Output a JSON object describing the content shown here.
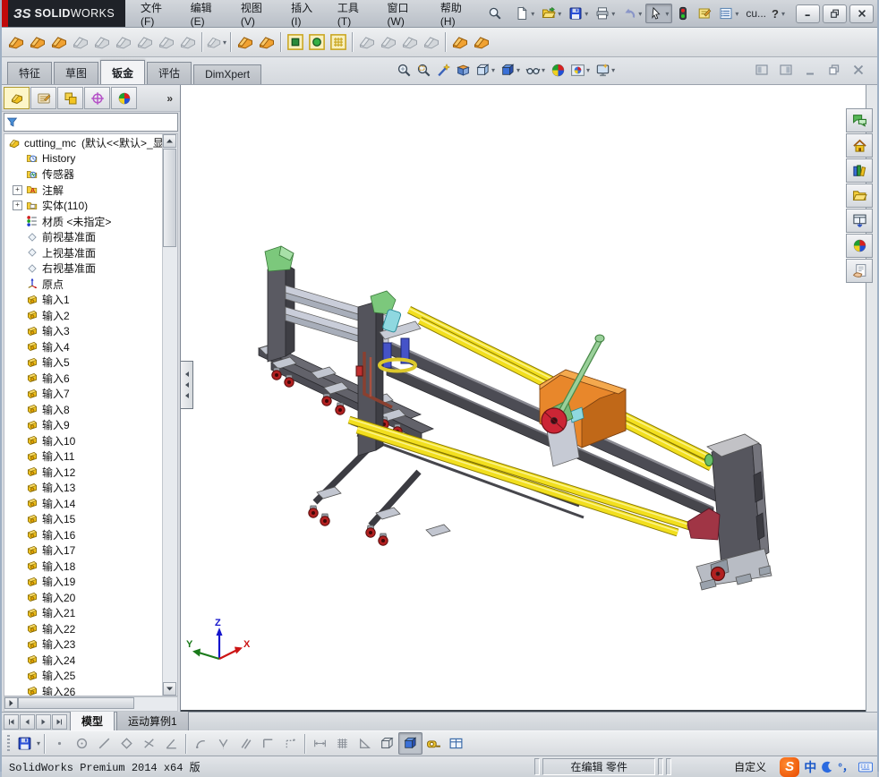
{
  "titlebar": {
    "logo_mark": "ЗS",
    "logo_bold": "SOLID",
    "logo_light": "WORKS",
    "menus": [
      "文件(F)",
      "编辑(E)",
      "视图(V)",
      "插入(I)",
      "工具(T)",
      "窗口(W)",
      "帮助(H)"
    ],
    "quickbar": [
      {
        "icon": "new-document",
        "dd": true
      },
      {
        "icon": "open-folder",
        "dd": true
      },
      {
        "icon": "save-floppy",
        "dd": true
      },
      {
        "icon": "print",
        "dd": true
      },
      {
        "icon": "undo-arrow",
        "dd": true
      },
      {
        "icon": "select-cursor",
        "dd": true,
        "pressed": true
      },
      {
        "icon": "rebuild-traffic-light"
      },
      {
        "icon": "edit-note"
      },
      {
        "icon": "options-list",
        "dd": true
      }
    ],
    "doc_overflow": "cu...",
    "help_mark": "?",
    "window_buttons": [
      "minimize",
      "restore",
      "close"
    ]
  },
  "sheetmetal_toolbar": [
    {
      "name": "base-flange",
      "style": "colored"
    },
    {
      "name": "convert-to-sheetmetal",
      "style": "colored"
    },
    {
      "name": "lofted-bend",
      "style": "colored"
    },
    {
      "name": "edge-flange",
      "style": "gray"
    },
    {
      "name": "miter-flange",
      "style": "gray"
    },
    {
      "name": "hem",
      "style": "gray"
    },
    {
      "name": "jog",
      "style": "gray"
    },
    {
      "name": "sketched-bend",
      "style": "gray"
    },
    {
      "name": "cross-break",
      "style": "gray"
    },
    {
      "name": "corner",
      "style": "gray",
      "dd": true,
      "sep_before": true
    },
    {
      "name": "forming-tool",
      "style": "colored",
      "sep_before": true
    },
    {
      "name": "sheet-metal-gusset",
      "style": "colored"
    },
    {
      "name": "extruded-cut",
      "style": "ybox-square",
      "sep_before": true
    },
    {
      "name": "simple-hole",
      "style": "ybox-ball"
    },
    {
      "name": "vent",
      "style": "ybox-grid"
    },
    {
      "name": "unfold",
      "style": "gray",
      "sep_before": true
    },
    {
      "name": "fold",
      "style": "gray"
    },
    {
      "name": "flatten",
      "style": "gray"
    },
    {
      "name": "no-bends",
      "style": "gray"
    },
    {
      "name": "rip",
      "style": "colored",
      "sep_before": true
    },
    {
      "name": "insert-bends",
      "style": "colored"
    }
  ],
  "command_tabs": [
    {
      "label": "特征"
    },
    {
      "label": "草图"
    },
    {
      "label": "钣金",
      "active": true
    },
    {
      "label": "评估"
    },
    {
      "label": "DimXpert"
    }
  ],
  "headsup": [
    {
      "icon": "zoom-fit"
    },
    {
      "icon": "zoom-area"
    },
    {
      "icon": "previous-view-wand"
    },
    {
      "icon": "section-view"
    },
    {
      "icon": "view-orientation",
      "dd": true
    },
    {
      "icon": "display-style",
      "dd": true
    },
    {
      "icon": "hide-show-items",
      "dd": true
    },
    {
      "icon": "edit-appearance"
    },
    {
      "icon": "apply-scene",
      "dd": true
    },
    {
      "icon": "view-settings",
      "dd": true
    }
  ],
  "docwin_buttons": [
    "pane-left",
    "pane-right",
    "doc-minimize",
    "doc-restore",
    "doc-close"
  ],
  "panel": {
    "toolbar": [
      {
        "icon": "featuremanager-tree",
        "active": true
      },
      {
        "icon": "propertymanager"
      },
      {
        "icon": "configurationmanager"
      },
      {
        "icon": "dimxpertmanager"
      },
      {
        "icon": "displaymanager"
      }
    ],
    "overflow": "»",
    "filter_icon": "filter-funnel"
  },
  "tree": {
    "root_label": "cutting_mc",
    "root_config": "(默认<<默认>_显",
    "items": [
      {
        "icon": "history",
        "label": "History"
      },
      {
        "icon": "sensors",
        "label": "传感器"
      },
      {
        "icon": "annotations",
        "label": "注解",
        "expand": true
      },
      {
        "icon": "solids",
        "label": "实体(110)",
        "expand": true
      },
      {
        "icon": "material",
        "label": "材质 <未指定>"
      },
      {
        "icon": "plane",
        "label": "前视基准面"
      },
      {
        "icon": "plane",
        "label": "上视基准面"
      },
      {
        "icon": "plane",
        "label": "右视基准面"
      },
      {
        "icon": "origin",
        "label": "原点"
      },
      {
        "icon": "input",
        "label": "输入1"
      },
      {
        "icon": "input",
        "label": "输入2"
      },
      {
        "icon": "input",
        "label": "输入3"
      },
      {
        "icon": "input",
        "label": "输入4"
      },
      {
        "icon": "input",
        "label": "输入5"
      },
      {
        "icon": "input",
        "label": "输入6"
      },
      {
        "icon": "input",
        "label": "输入7"
      },
      {
        "icon": "input",
        "label": "输入8"
      },
      {
        "icon": "input",
        "label": "输入9"
      },
      {
        "icon": "input",
        "label": "输入10"
      },
      {
        "icon": "input",
        "label": "输入11"
      },
      {
        "icon": "input",
        "label": "输入12"
      },
      {
        "icon": "input",
        "label": "输入13"
      },
      {
        "icon": "input",
        "label": "输入14"
      },
      {
        "icon": "input",
        "label": "输入15"
      },
      {
        "icon": "input",
        "label": "输入16"
      },
      {
        "icon": "input",
        "label": "输入17"
      },
      {
        "icon": "input",
        "label": "输入18"
      },
      {
        "icon": "input",
        "label": "输入19"
      },
      {
        "icon": "input",
        "label": "输入20"
      },
      {
        "icon": "input",
        "label": "输入21"
      },
      {
        "icon": "input",
        "label": "输入22"
      },
      {
        "icon": "input",
        "label": "输入23"
      },
      {
        "icon": "input",
        "label": "输入24"
      },
      {
        "icon": "input",
        "label": "输入25"
      },
      {
        "icon": "input",
        "label": "输入26"
      }
    ]
  },
  "taskpane": [
    "forum-chat",
    "home",
    "design-library",
    "file-explorer",
    "view-palette",
    "appearances-ball",
    "custom-properties"
  ],
  "viewport": {
    "triad": {
      "x": "X",
      "y": "Y",
      "z": "Z"
    },
    "model_colors": {
      "rod_yellow": "#f2df1e",
      "frame_dark": "#4c4c54",
      "beam_light": "#c9cdd9",
      "housing_orange": "#e8872b",
      "cap_green": "#7cc87c",
      "wheel_red": "#b22020",
      "blade_red": "#cc2535",
      "cylinder_blue": "#4553c8",
      "tube_cyan": "#8fd8e0",
      "bracket_maroon": "#a03545"
    }
  },
  "bottom_tabs": {
    "nav": [
      "tab-first",
      "tab-prev",
      "tab-next",
      "tab-last"
    ],
    "tabs": [
      {
        "label": "模型",
        "active": true
      },
      {
        "label": "运动算例1"
      }
    ]
  },
  "bottom_toolbar": [
    {
      "name": "save-floppy",
      "style": "colored"
    },
    {
      "name": "dropdown",
      "style": "dd"
    },
    {
      "name": "sep"
    },
    {
      "name": "sketch-point",
      "style": "gray"
    },
    {
      "name": "sketch-circle",
      "style": "gray"
    },
    {
      "name": "sketch-line",
      "style": "gray"
    },
    {
      "name": "sketch-polygon",
      "style": "gray"
    },
    {
      "name": "sketch-cross",
      "style": "gray"
    },
    {
      "name": "sketch-angle",
      "style": "gray"
    },
    {
      "name": "sep"
    },
    {
      "name": "sketch-arc",
      "style": "gray"
    },
    {
      "name": "sketch-mirror",
      "style": "gray"
    },
    {
      "name": "sketch-parallel",
      "style": "gray"
    },
    {
      "name": "sketch-corner",
      "style": "gray"
    },
    {
      "name": "sketch-trail",
      "style": "gray"
    },
    {
      "name": "sep"
    },
    {
      "name": "dimension",
      "style": "gray"
    },
    {
      "name": "grid-hatch",
      "style": "gray"
    },
    {
      "name": "angle-triangle",
      "style": "gray"
    },
    {
      "name": "wireframe-cube",
      "style": "gray"
    },
    {
      "name": "shaded-cube",
      "style": "active"
    },
    {
      "name": "measure-tape",
      "style": "colored"
    },
    {
      "name": "design-table",
      "style": "colored"
    }
  ],
  "statusbar": {
    "left_text": "SolidWorks Premium 2014 x64 版",
    "editing": "在编辑  零件",
    "custom": "自定义",
    "ime": {
      "sogou": "S",
      "lang": "中",
      "moon": "moon-icon",
      "punct": "°，",
      "keyboard": "keyboard-icon"
    }
  }
}
